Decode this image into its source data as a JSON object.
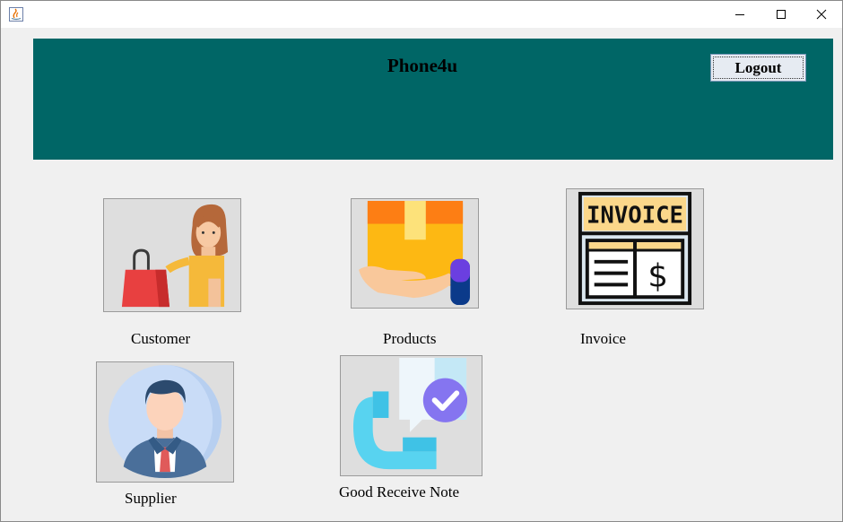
{
  "window": {
    "controls": {
      "minimize_icon": "minimize-icon",
      "maximize_icon": "maximize-icon",
      "close_icon": "close-icon"
    }
  },
  "header": {
    "title": "Phone4u",
    "logout_label": "Logout",
    "background": "#006666"
  },
  "modules": {
    "customer": {
      "label": "Customer",
      "icon": "shopper-woman-icon"
    },
    "products": {
      "label": "Products",
      "icon": "package-in-hand-icon"
    },
    "invoice": {
      "label": "Invoice",
      "icon": "invoice-icon"
    },
    "supplier": {
      "label": "Supplier",
      "icon": "businessman-avatar-icon"
    },
    "grn": {
      "label": "Good Receive Note",
      "icon": "received-checkmark-icon"
    }
  }
}
